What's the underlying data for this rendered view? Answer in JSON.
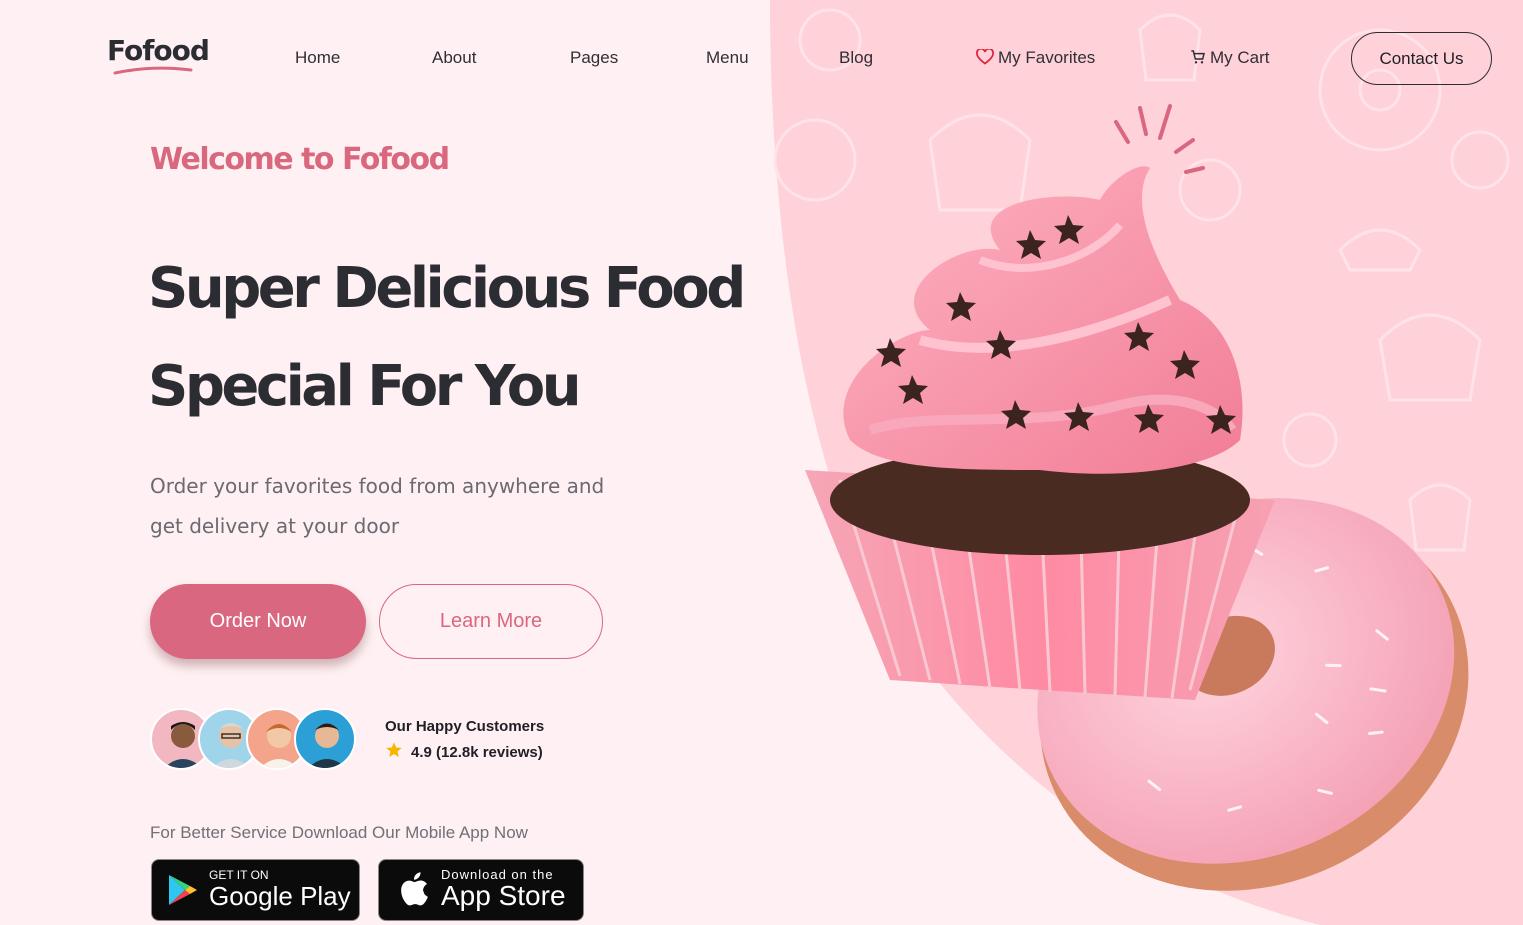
{
  "brand": {
    "logo_text": "Fofood",
    "accent": "#d9677f",
    "dark": "#2c2c33"
  },
  "nav": {
    "items": [
      {
        "label": "Home"
      },
      {
        "label": "About"
      },
      {
        "label": "Pages"
      },
      {
        "label": "Menu"
      },
      {
        "label": "Blog"
      }
    ],
    "favorites": {
      "label": "My Favorites",
      "icon": "heart-icon"
    },
    "cart": {
      "label": "My Cart",
      "icon": "cart-icon"
    },
    "contact_label": "Contact Us"
  },
  "hero": {
    "welcome": "Welcome to Fofood",
    "headline_line1": "Super Delicious Food",
    "headline_line2": "Special For You",
    "subtext_line1": "Order your favorites food from anywhere and",
    "subtext_line2": "get delivery at your door",
    "order_button": "Order Now",
    "learn_button": "Learn More"
  },
  "customers": {
    "title": "Our Happy Customers",
    "rating": "4.9 (12.8k reviews)",
    "avatar_count": 4
  },
  "app": {
    "note": "For Better Service Download Our Mobile App Now",
    "google_small": "GET IT ON",
    "google_big": "Google Play",
    "apple_small": "Download on the",
    "apple_big": "App Store"
  }
}
